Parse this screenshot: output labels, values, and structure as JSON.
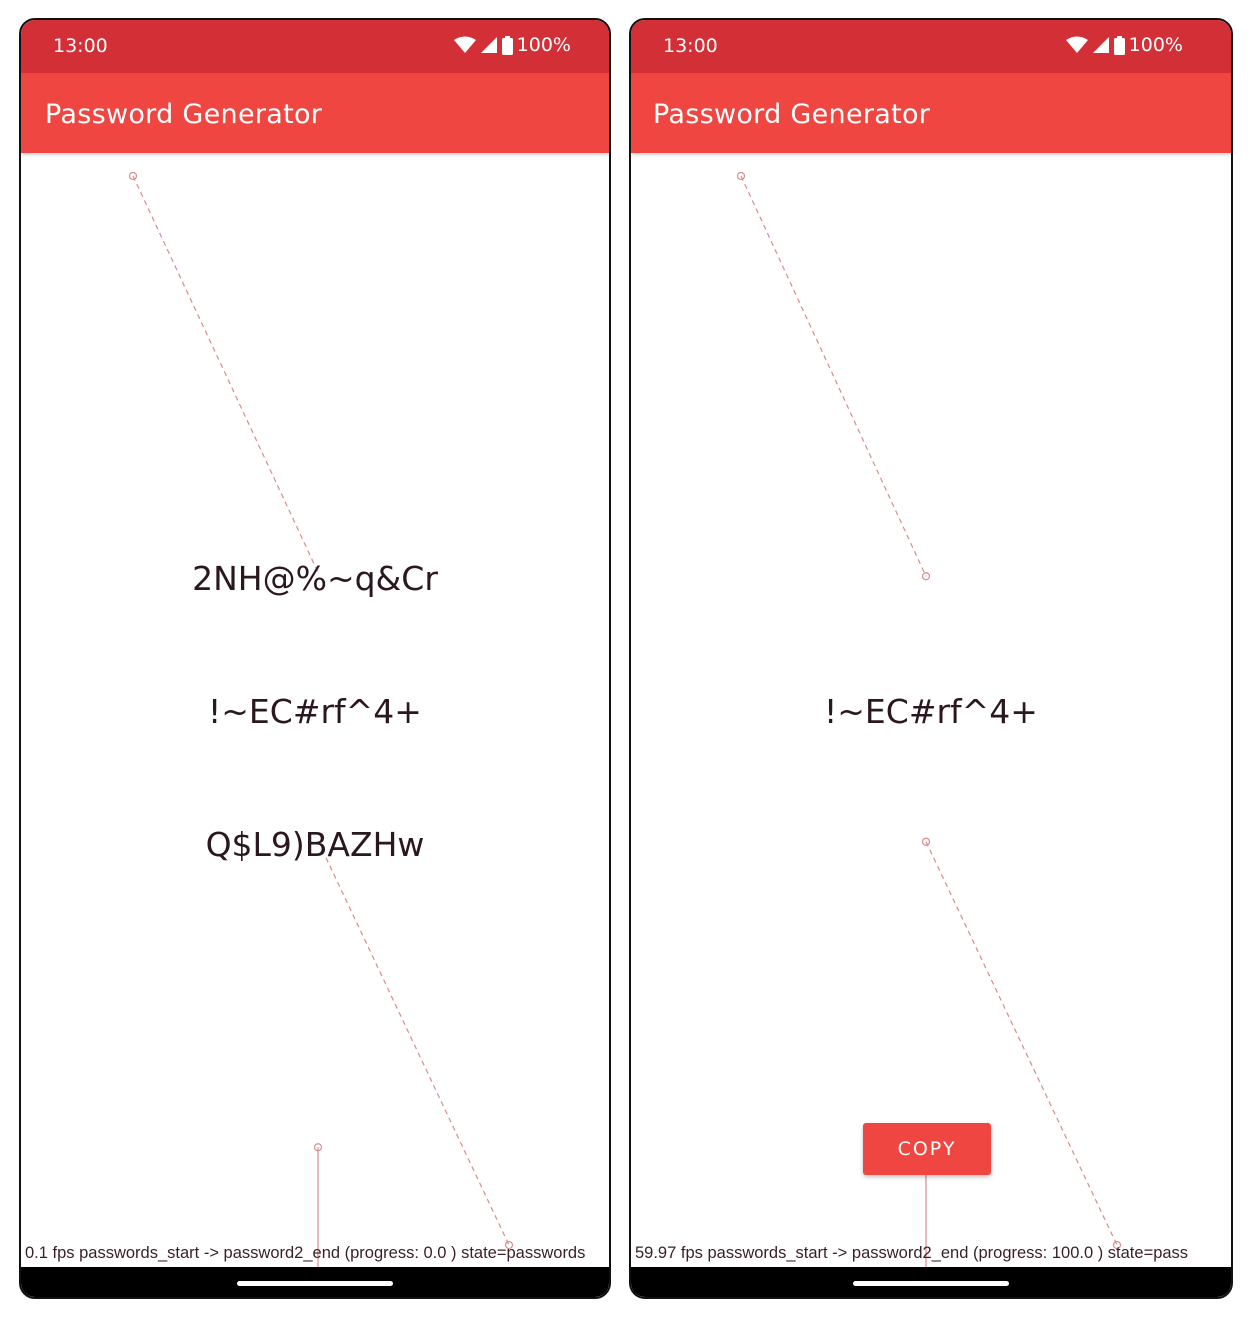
{
  "screens": [
    {
      "status": {
        "time": "13:00",
        "battery": "100%"
      },
      "app_title": "Password Generator",
      "passwords": [
        "2NH@%~q&Cr",
        "!~EC#rf^4+",
        "Q$L9)BAZHw"
      ],
      "debug": "0.1 fps passwords_start -> password2_end (progress: 0.0 ) state=passwords",
      "progress": 0.0
    },
    {
      "status": {
        "time": "13:00",
        "battery": "100%"
      },
      "app_title": "Password Generator",
      "passwords": [
        "!~EC#rf^4+"
      ],
      "copy_label": "COPY",
      "debug": "59.97 fps passwords_start -> password2_end (progress: 100.0 ) state=pass",
      "progress": 100.0
    }
  ],
  "colors": {
    "status_bar": "#d32f36",
    "app_bar": "#f04641",
    "accent": "#f04641",
    "text": "#2a1720",
    "motion_path": "#d98b8b"
  },
  "icons": [
    "wifi-icon",
    "signal-icon",
    "battery-icon"
  ]
}
